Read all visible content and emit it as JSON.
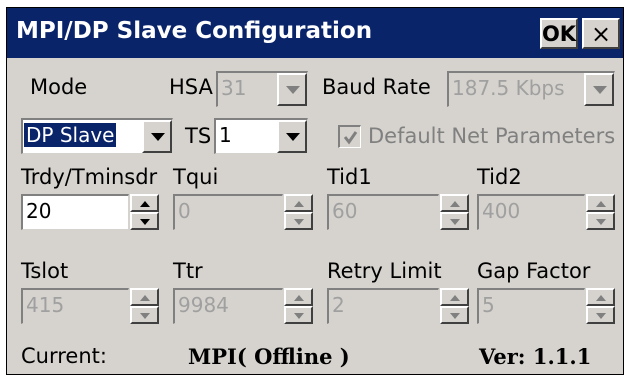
{
  "window": {
    "title": "MPI/DP Slave Configuration",
    "ok_label": "OK",
    "close_label": "×"
  },
  "mode": {
    "label": "Mode",
    "value": "DP Slave"
  },
  "hsa": {
    "label": "HSA",
    "value": "31"
  },
  "baud_rate": {
    "label": "Baud Rate",
    "value": "187.5 Kbps"
  },
  "ts": {
    "label": "TS",
    "value": "1"
  },
  "default_net": {
    "label": "Default Net Parameters",
    "checked": true
  },
  "params": {
    "trdy": {
      "label": "Trdy/Tminsdr",
      "value": "20"
    },
    "tqui": {
      "label": "Tqui",
      "value": "0"
    },
    "tid1": {
      "label": "Tid1",
      "value": "60"
    },
    "tid2": {
      "label": "Tid2",
      "value": "400"
    },
    "tslot": {
      "label": "Tslot",
      "value": "415"
    },
    "ttr": {
      "label": "Ttr",
      "value": "9984"
    },
    "retry_limit": {
      "label": "Retry Limit",
      "value": "2"
    },
    "gap_factor": {
      "label": "Gap Factor",
      "value": "5"
    }
  },
  "status": {
    "current_label": "Current:",
    "current_value": "MPI( Offline )",
    "version": "Ver: 1.1.1"
  },
  "icons": {
    "dropdown": "chevron-down-icon",
    "spin_up": "arrow-up-icon",
    "spin_down": "arrow-down-icon",
    "check": "check-icon"
  },
  "colors": {
    "titlebar": "#0a246a",
    "face": "#d6d3ce",
    "disabled_text": "#808080"
  }
}
